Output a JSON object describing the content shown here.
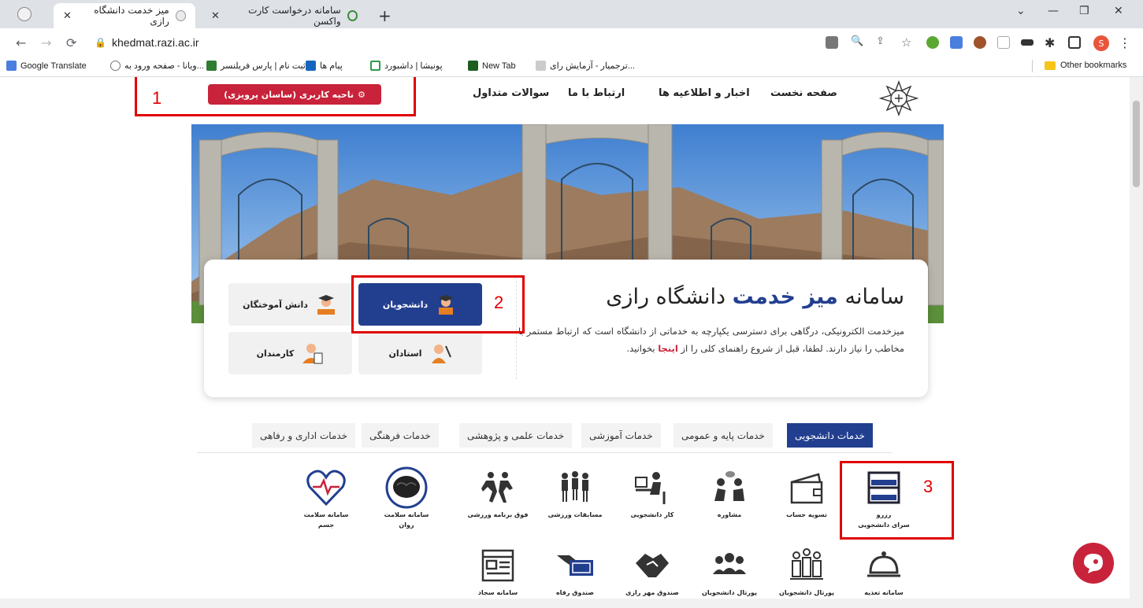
{
  "browser": {
    "tabs": [
      {
        "title": "میز خدمت دانشگاه رازی"
      },
      {
        "title": "سامانه درخواست کارت واکسن"
      }
    ],
    "url": "khedmat.razi.ac.ir",
    "bookmarks": [
      "Google Translate",
      "ویانا - صفحه ورود به...",
      "ثبت نام | پارس فریلنسر",
      "پیام ها",
      "پونیشا | داشبورد",
      "New Tab",
      "ترجمیار - آزمایش رای..."
    ],
    "other_bookmarks": "Other bookmarks",
    "profile_initial": "S"
  },
  "header": {
    "menu": [
      "صفحه نخست",
      "اخبار و اطلاعیه ها",
      "ارتباط با ما",
      "سوالات متداول"
    ],
    "user_button": "ناحیه کاربری (ساسان پرویزی)"
  },
  "card": {
    "title_prefix": "سامانه",
    "title_highlight": "میز خدمت",
    "title_suffix": "دانشگاه رازی",
    "desc_main": "میزخدمت الکترونیکی، درگاهی برای دسترسی یکپارچه به خدماتی از دانشگاه است که ارتباط مستمر با مخاطب را نیاز دارند. لطفا، قبل از شروع راهنمای کلی را از",
    "desc_link": "اینجا",
    "desc_end": "بخوانید."
  },
  "roles": {
    "students": "دانشجویان",
    "alumni": "دانش آموختگان",
    "professors": "استادان",
    "staff": "کارمندان"
  },
  "service_tabs": [
    "خدمات دانشجویی",
    "خدمات پایه و عمومی",
    "خدمات آموزشی",
    "خدمات علمی و پژوهشی",
    "خدمات فرهنگی",
    "خدمات اداری و رفاهی"
  ],
  "services_row1": [
    {
      "label1": "رزرو",
      "label2": "سرای دانشجویی",
      "icon": "bunk-bed-icon"
    },
    {
      "label1": "تسویه حساب",
      "label2": "",
      "icon": "wallet-icon"
    },
    {
      "label1": "مشاوره",
      "label2": "",
      "icon": "counseling-icon"
    },
    {
      "label1": "کار دانشجویی",
      "label2": "",
      "icon": "desk-work-icon"
    },
    {
      "label1": "مسابقات ورزشی",
      "label2": "",
      "icon": "team-icon"
    },
    {
      "label1": "فوق برنامه ورزشی",
      "label2": "",
      "icon": "runners-icon"
    },
    {
      "label1": "سامانه سلامت",
      "label2": "روان",
      "icon": "brain-icon"
    },
    {
      "label1": "سامانه سلامت",
      "label2": "جسم",
      "icon": "heart-icon"
    }
  ],
  "services_row2": [
    {
      "label1": "سامانه تغذیه",
      "icon": "food-tray-icon"
    },
    {
      "label1": "پورتال دانشجویان",
      "icon": "students-portal-icon"
    },
    {
      "label1": "پورتال دانشجویان",
      "icon": "group-icon"
    },
    {
      "label1": "صندوق مهر رازی",
      "icon": "handshake-icon"
    },
    {
      "label1": "صندوق رفاه",
      "icon": "payment-icon"
    },
    {
      "label1": "سامانه سجاد",
      "icon": "window-icon"
    }
  ],
  "annotations": [
    "1",
    "2",
    "3"
  ],
  "colors": {
    "brand_blue": "#223f8f",
    "brand_red": "#c8233a",
    "annotation_red": "#e00000"
  }
}
